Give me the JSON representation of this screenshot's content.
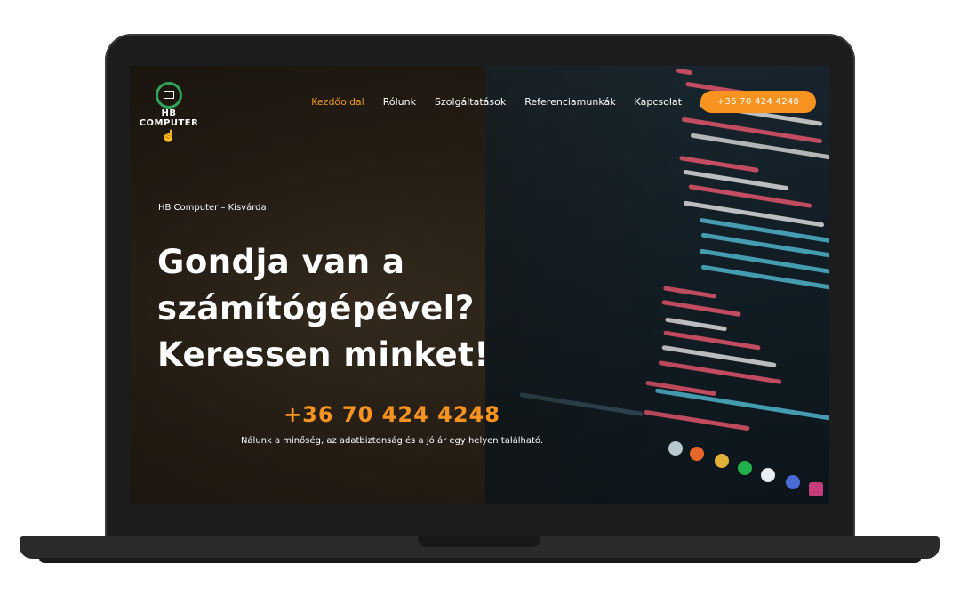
{
  "header": {
    "logo_text_1": "HB",
    "logo_text_2": "COMPUTER",
    "nav": [
      {
        "label": "Kezdőoldal",
        "active": true
      },
      {
        "label": "Rólunk",
        "active": false
      },
      {
        "label": "Szolgáltatások",
        "active": false
      },
      {
        "label": "Referenciamunkák",
        "active": false
      },
      {
        "label": "Kapcsolat",
        "active": false
      }
    ],
    "phone_button": "+36 70 424 4248"
  },
  "hero": {
    "kicker": "HB Computer – Kisvárda",
    "headline_1": "Gondja van a",
    "headline_2": "számítógépével?",
    "headline_3": "Keressen minket!",
    "phone": "+36 70 424 4248",
    "tagline": "Nálunk a minőség, az adatbiztonság és a jó ár egy helyen található."
  },
  "colors": {
    "accent": "#f7931e",
    "logo_ring": "#2fa35a"
  }
}
